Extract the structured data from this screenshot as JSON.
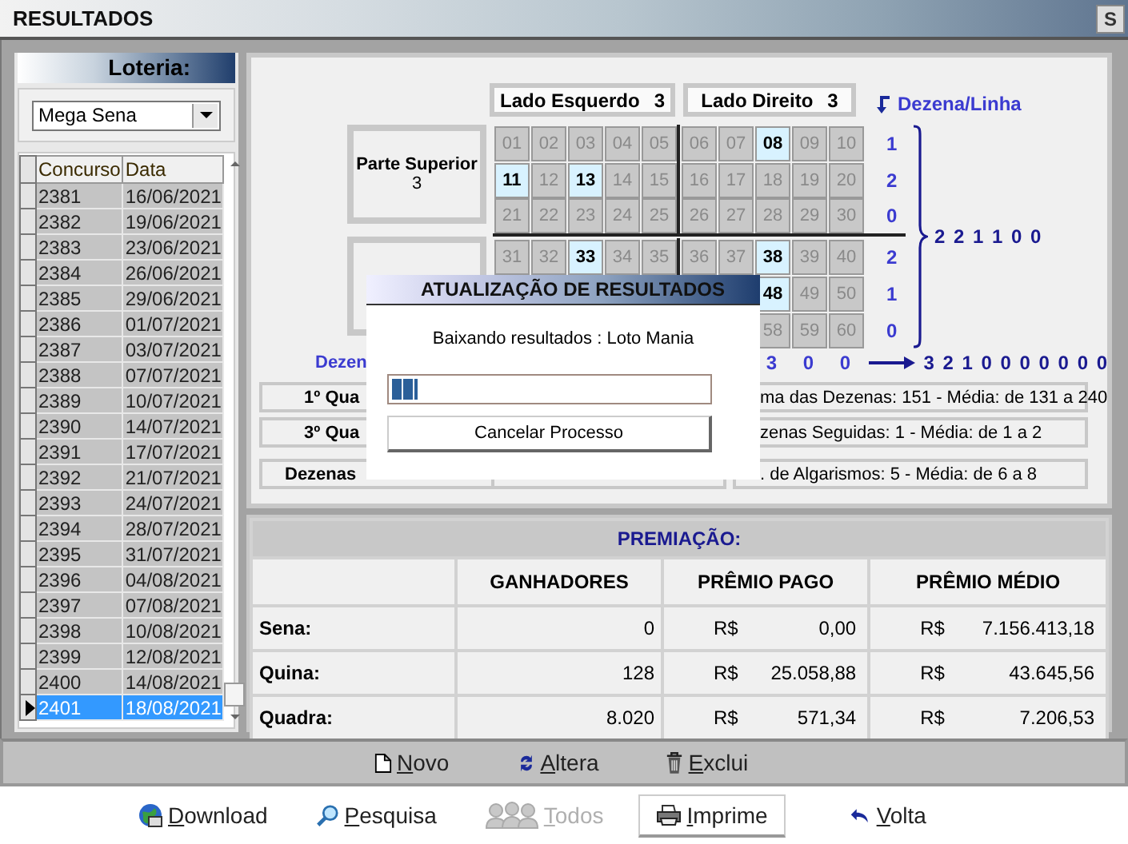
{
  "window": {
    "title": "RESULTADOS",
    "corner_button": "S"
  },
  "lottery": {
    "label": "Loteria:",
    "value": "Mega Sena"
  },
  "draws": {
    "columns": [
      "Concurso",
      "Data"
    ],
    "rows": [
      {
        "number": "2381",
        "date": "16/06/2021",
        "selected": false
      },
      {
        "number": "2382",
        "date": "19/06/2021",
        "selected": false
      },
      {
        "number": "2383",
        "date": "23/06/2021",
        "selected": false
      },
      {
        "number": "2384",
        "date": "26/06/2021",
        "selected": false
      },
      {
        "number": "2385",
        "date": "29/06/2021",
        "selected": false
      },
      {
        "number": "2386",
        "date": "01/07/2021",
        "selected": false
      },
      {
        "number": "2387",
        "date": "03/07/2021",
        "selected": false
      },
      {
        "number": "2388",
        "date": "07/07/2021",
        "selected": false
      },
      {
        "number": "2389",
        "date": "10/07/2021",
        "selected": false
      },
      {
        "number": "2390",
        "date": "14/07/2021",
        "selected": false
      },
      {
        "number": "2391",
        "date": "17/07/2021",
        "selected": false
      },
      {
        "number": "2392",
        "date": "21/07/2021",
        "selected": false
      },
      {
        "number": "2393",
        "date": "24/07/2021",
        "selected": false
      },
      {
        "number": "2394",
        "date": "28/07/2021",
        "selected": false
      },
      {
        "number": "2395",
        "date": "31/07/2021",
        "selected": false
      },
      {
        "number": "2396",
        "date": "04/08/2021",
        "selected": false
      },
      {
        "number": "2397",
        "date": "07/08/2021",
        "selected": false
      },
      {
        "number": "2398",
        "date": "10/08/2021",
        "selected": false
      },
      {
        "number": "2399",
        "date": "12/08/2021",
        "selected": false
      },
      {
        "number": "2400",
        "date": "14/08/2021",
        "selected": false
      },
      {
        "number": "2401",
        "date": "18/08/2021",
        "selected": true
      }
    ]
  },
  "board": {
    "left_side": {
      "label": "Lado Esquerdo",
      "count": "3"
    },
    "right_side": {
      "label": "Lado Direito",
      "count": "3"
    },
    "top_part": {
      "label": "Parte Superior",
      "count": "3"
    },
    "rows_label": "Dezena/Linha",
    "rows": [
      {
        "count": "1",
        "cells": [
          {
            "n": "01",
            "selected": false
          },
          {
            "n": "02",
            "selected": false
          },
          {
            "n": "03",
            "selected": false
          },
          {
            "n": "04",
            "selected": false
          },
          {
            "n": "05",
            "selected": false
          },
          {
            "n": "06",
            "selected": false
          },
          {
            "n": "07",
            "selected": false
          },
          {
            "n": "08",
            "selected": true
          },
          {
            "n": "09",
            "selected": false
          },
          {
            "n": "10",
            "selected": false
          }
        ]
      },
      {
        "count": "2",
        "cells": [
          {
            "n": "11",
            "selected": true
          },
          {
            "n": "12",
            "selected": false
          },
          {
            "n": "13",
            "selected": true
          },
          {
            "n": "14",
            "selected": false
          },
          {
            "n": "15",
            "selected": false
          },
          {
            "n": "16",
            "selected": false
          },
          {
            "n": "17",
            "selected": false
          },
          {
            "n": "18",
            "selected": false
          },
          {
            "n": "19",
            "selected": false
          },
          {
            "n": "20",
            "selected": false
          }
        ]
      },
      {
        "count": "0",
        "cells": [
          {
            "n": "21",
            "selected": false
          },
          {
            "n": "22",
            "selected": false
          },
          {
            "n": "23",
            "selected": false
          },
          {
            "n": "24",
            "selected": false
          },
          {
            "n": "25",
            "selected": false
          },
          {
            "n": "26",
            "selected": false
          },
          {
            "n": "27",
            "selected": false
          },
          {
            "n": "28",
            "selected": false
          },
          {
            "n": "29",
            "selected": false
          },
          {
            "n": "30",
            "selected": false
          }
        ]
      },
      {
        "count": "2",
        "cells": [
          {
            "n": "31",
            "selected": false
          },
          {
            "n": "32",
            "selected": false
          },
          {
            "n": "33",
            "selected": true
          },
          {
            "n": "34",
            "selected": false
          },
          {
            "n": "35",
            "selected": false
          },
          {
            "n": "36",
            "selected": false
          },
          {
            "n": "37",
            "selected": false
          },
          {
            "n": "38",
            "selected": true
          },
          {
            "n": "39",
            "selected": false
          },
          {
            "n": "40",
            "selected": false
          }
        ]
      },
      {
        "count": "1",
        "cells": [
          {
            "n": "48",
            "selected": true
          },
          {
            "n": "49",
            "selected": false
          },
          {
            "n": "50",
            "selected": false
          }
        ]
      },
      {
        "count": "0",
        "cells": [
          {
            "n": "58",
            "selected": false
          },
          {
            "n": "59",
            "selected": false
          },
          {
            "n": "60",
            "selected": false
          }
        ]
      }
    ],
    "row_summary": "2 2 1 1 0 0",
    "columns_label": "Dezen",
    "column_counts": [
      "3",
      "0",
      "0"
    ],
    "column_summary": "3 2 1 0 0 0 0 0 0 0"
  },
  "stats": {
    "left": [
      "1º Qua",
      "3º Qua",
      "Dezenas"
    ],
    "right": [
      "ma das Dezenas: 151 - Média: de 131 a 240",
      "zenas Seguidas: 1 - Média: de 1 a 2",
      ". de Algarismos: 5 - Média: de 6 a 8"
    ]
  },
  "prizes": {
    "title": "PREMIAÇÃO:",
    "columns": [
      "GANHADORES",
      "PRÊMIO PAGO",
      "PRÊMIO MÉDIO"
    ],
    "rows": [
      {
        "label": "Sena:",
        "winners": "0",
        "paid_currency": "R$",
        "paid": "0,00",
        "average_currency": "R$",
        "average": "7.156.413,18"
      },
      {
        "label": "Quina:",
        "winners": "128",
        "paid_currency": "R$",
        "paid": "25.058,88",
        "average_currency": "R$",
        "average": "43.645,56"
      },
      {
        "label": "Quadra:",
        "winners": "8.020",
        "paid_currency": "R$",
        "paid": "571,34",
        "average_currency": "R$",
        "average": "7.206,53"
      }
    ]
  },
  "toolbar": [
    {
      "label": "Novo",
      "kind": "new"
    },
    {
      "label": "Altera",
      "kind": "edit"
    },
    {
      "label": "Exclui",
      "kind": "delete"
    }
  ],
  "actions": [
    {
      "label": "Download",
      "kind": "download",
      "disabled": false,
      "focused": false
    },
    {
      "label": "Pesquisa",
      "kind": "search",
      "disabled": false,
      "focused": false
    },
    {
      "label": "Todos",
      "kind": "all",
      "disabled": true,
      "focused": false
    },
    {
      "label": "Imprime",
      "kind": "print",
      "disabled": false,
      "focused": true
    },
    {
      "label": "Volta",
      "kind": "back",
      "disabled": false,
      "focused": false
    }
  ],
  "dialog": {
    "title": "ATUALIZAÇÃO DE RESULTADOS",
    "message": "Baixando resultados : Loto Mania",
    "progress": {
      "level": 0.08
    },
    "button": "Cancelar Processo"
  }
}
